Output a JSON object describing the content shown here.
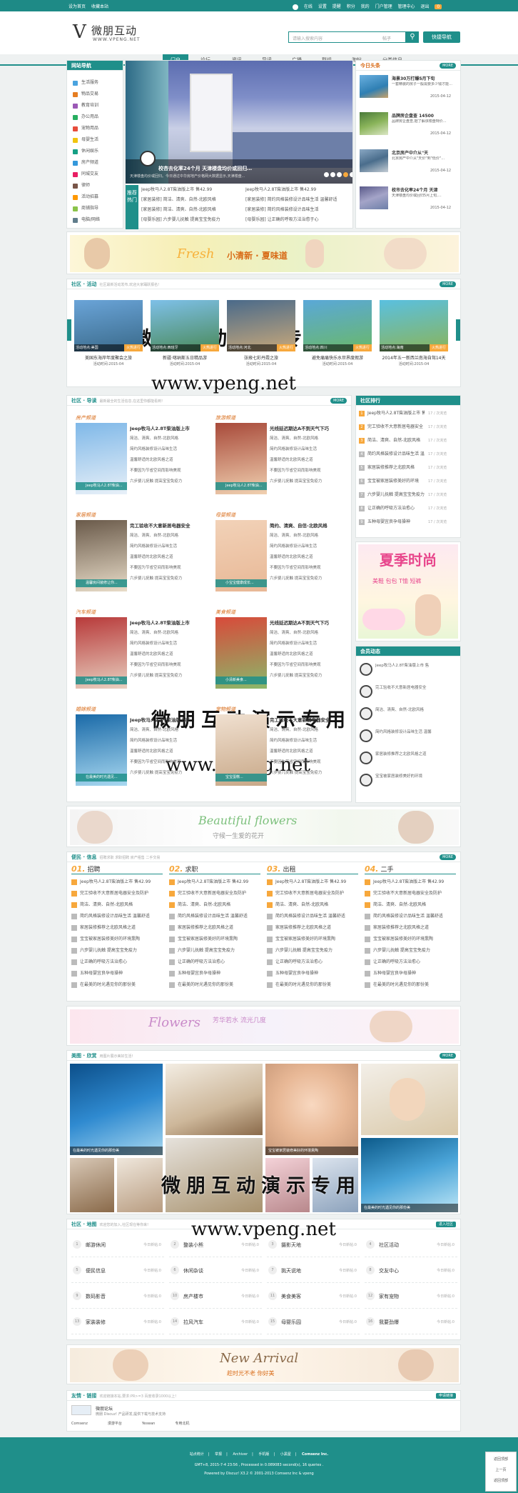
{
  "topbar": {
    "left": [
      "设为首页",
      "收藏本站"
    ],
    "right": [
      "在线",
      "设置",
      "提醒",
      "积分",
      "我的",
      "门户管理",
      "管理中心",
      "退出"
    ],
    "badge": "0"
  },
  "header": {
    "logo_text": "微朋互动",
    "logo_url": "WWW.VPENG.NET",
    "search_placeholder": "请输入搜索内容",
    "search_type": "帖子",
    "quick_nav": "快捷导航"
  },
  "nav": [
    "门户",
    "论坛",
    "资讯",
    "导读",
    "广播",
    "群组",
    "淘帖",
    "分类信息"
  ],
  "sidebar": {
    "title": "网站导航",
    "items": [
      "生活服务",
      "物品交易",
      "教育培训",
      "办公用品",
      "宠物用品",
      "母婴生活",
      "休闲娱乐",
      "房产频道",
      "同城交友",
      "律师",
      "活动招募",
      "商铺指导",
      "电脑/网络"
    ]
  },
  "slider": {
    "caption": "校杏去化率24个月 天津楼盘均价或回归…",
    "desc": "天津楼盘均价或回归。今日通过中华房地产价格网大数据显示,天津楼盘...",
    "dots": [
      "1",
      "2",
      "3",
      "4",
      "5"
    ]
  },
  "recommend": {
    "label": "推荐热门",
    "rows": [
      [
        "Jeep牧马人2.8T柴油版上市 售42.99",
        "Jeep牧马人2.8T柴油版上市 售42.99"
      ],
      [
        "[家居装修] 简洁、清爽、自然-北欧风格",
        "[家居装修] 简约风格装修设计品味生活 温馨舒适"
      ],
      [
        "[家居装修] 简洁、清爽、自然-北欧风格",
        "[家居装修] 简约风格装修设计品味生活"
      ],
      [
        "[母婴乐园] 六步婴儿抚触 提高宝宝免疫力",
        "[母婴乐园] 让正确的呼吸方法治愈于心"
      ]
    ]
  },
  "today": {
    "title": "今日头条",
    "more": "MORE",
    "items": [
      {
        "t": "海景30万打爆5月下旬",
        "d": "一套精装的房子一般需要多少钱才能…",
        "date": "2015-04-12"
      },
      {
        "t": "品牌房企盘查 14500",
        "d": "品牌房企盘查,据了解该楼盘特价…",
        "date": "2015-04-12"
      },
      {
        "t": "北京房产中介从\"天",
        "d": "北京房产中介从\"天价\"到\"低价\"…",
        "date": "2015-04-12"
      },
      {
        "t": "校市去化率24个月 天津",
        "d": "天津楼盘均价或回归5月上旬,…",
        "date": "2015-04-12"
      }
    ]
  },
  "banner1": {
    "text": "小清新 · 夏味道",
    "script": "Fresh"
  },
  "activity": {
    "title": "社区 · 活动",
    "sub": "社区最新活动发布,欢迎大家踊跃报名!",
    "more": "MORE",
    "items": [
      {
        "place": "活动地点:美国",
        "status": "火热进行",
        "t": "美国东海岸年度聚会之旅",
        "d": "活动时间:2015-04"
      },
      {
        "place": "活动地点:西班牙",
        "status": "火热进行",
        "t": "新疆·喀纳斯五日精品游",
        "d": "活动时间:2015-04"
      },
      {
        "place": "活动地点:河北",
        "status": "火热进行",
        "t": "张掖七彩丹霞之旅",
        "d": "活动时间:2015-04"
      },
      {
        "place": "活动地点:四川",
        "status": "火热进行",
        "t": "避免痛痛快乐水世界度假游",
        "d": "活动时间:2015-04"
      },
      {
        "place": "活动地点:海南",
        "status": "火热进行",
        "t": "2014年五一新西兰南海自驾14天",
        "d": "活动时间:2015-04"
      }
    ]
  },
  "watermark": {
    "cn": "微朋互动演示专用",
    "url": "www.vpeng.net"
  },
  "guide": {
    "title": "社区 · 导读",
    "sub": "最新最全的生活信息,在这里你都能看到!",
    "more": "MORE",
    "cats": [
      {
        "name": "房产频道",
        "t": "Jeep牧马人2.8T柴油版上市",
        "tag": "Jeep牧马人2.8T柴油..."
      },
      {
        "name": "旅游频道",
        "t": "光线延迟期达A不到天气下巧",
        "tag": "Jeep牧马人2.8T柴油..."
      },
      {
        "name": "家居频道",
        "t": "完工验收不大意新居电器安全",
        "tag": "温馨房间装修让你..."
      },
      {
        "name": "母婴频道",
        "t": "简约、清爽、自信-北欧风格",
        "tag": "小宝宝健康成长..."
      },
      {
        "name": "汽车频道",
        "t": "Jeep牧马人2.8T柴油版上市",
        "tag": "Jeep牧马人2.8T柴油..."
      },
      {
        "name": "美食频道",
        "t": "光线延迟期达A不到天气下巧",
        "tag": "小清新美食..."
      },
      {
        "name": "婚嫁频道",
        "t": "Jeep牧马人2.8T柴油版上市",
        "tag": "在最美的时光遇见..."
      },
      {
        "name": "宠物频道",
        "t": "完工验收不大意新居电器安全",
        "tag": "宝宝蛋糕..."
      }
    ],
    "lines": [
      "简洁、清爽、自然-北欧风格",
      "简约风格装修设计品味生活",
      "温馨舒适的北欧风格之道",
      "不要因为节省空间而影响美观",
      "六步婴儿抚触 提高宝宝免疫力"
    ]
  },
  "rank": {
    "title": "社区排行",
    "items": [
      "Jeep牧马人2.8T柴油版上市 售",
      "完工验收不大意新居电器安全",
      "简洁、清爽、自然-北欧风格",
      "简约风格装修设计品味生活 温",
      "家居装修推荐之北欧风格",
      "宝宝被家居装修美好的环境",
      "六步婴儿抚触 提高宝宝免疫力",
      "让正确的呼吸方法治愈心",
      "五种母婴宜良孕母操神"
    ],
    "dates": [
      "17 / 次浏览",
      "17 / 次浏览",
      "17 / 次浏览",
      "17 / 次浏览",
      "17 / 次浏览",
      "17 / 次浏览",
      "17 / 次浏览",
      "17 / 次浏览",
      "17 / 次浏览"
    ]
  },
  "summer": {
    "t1": "夏季时尚",
    "t2": "美鞋 包包 T恤 短裤"
  },
  "member": {
    "title": "会员动态",
    "items": [
      "Jeep牧马人2.8T柴油版上市 售",
      "完工验收不大意新居电器安全",
      "简洁、清爽、自然-北欧风格",
      "简约风格装修设计品味生活 温馨",
      "家居装修推荐之北欧风格之道",
      "宝宝被家居装修美好的环境"
    ]
  },
  "banner2": {
    "text": "Beautiful flowers",
    "sub": "守候一生爱的花开"
  },
  "info": {
    "title": "便民 · 信息",
    "sub": "招聘求职 求职招聘 房产租售 二手交易",
    "more": "MORE",
    "cols": [
      {
        "n": "01.",
        "t": "招聘"
      },
      {
        "n": "02.",
        "t": "求职"
      },
      {
        "n": "03.",
        "t": "出租"
      },
      {
        "n": "04.",
        "t": "二手"
      }
    ],
    "lines": [
      "Jeep牧马人2.8T柴油版上市 售42.99",
      "完工验收不大意新居电器安全及防护",
      "简洁、清爽、自然-北欧风格",
      "简约风格装修设计品味生活 温馨舒适",
      "家居装修推荐之北欧风格之道",
      "宝宝被家居装修美好的环境熏陶",
      "六步婴儿抚触 提高宝宝免疫力",
      "让正确的呼吸方法治愈心",
      "五种母婴宜良孕母操神",
      "在最美的时光遇见你的那份美"
    ]
  },
  "banner3": {
    "text": "Flowers",
    "sub": "芳华若水 流光几度"
  },
  "gallery": {
    "title": "美图 · 欣赏",
    "sub": "用图片展示美好生活!",
    "more": "MORE",
    "caps": [
      "在最美的时光遇见你的那份美",
      "宝宝被家居装修美好的环境熏陶",
      "在最美的时光遇见你的那份美"
    ]
  },
  "forum": {
    "title": "社区 · 地图",
    "sub": "欢迎您的加入,社区现在等你来!",
    "btn": "进入社区",
    "items": [
      {
        "n": "1",
        "t": "邮游休闲",
        "c": "今日新帖:0"
      },
      {
        "n": "2",
        "t": "整装小熊",
        "c": "今日新帖:0"
      },
      {
        "n": "3",
        "t": "摄影天地",
        "c": "今日新帖:0"
      },
      {
        "n": "4",
        "t": "社区活动",
        "c": "今日新帖:0"
      },
      {
        "n": "5",
        "t": "便民信息",
        "c": "今日新帖:0"
      },
      {
        "n": "6",
        "t": "休闲杂谈",
        "c": "今日新帖:0"
      },
      {
        "n": "7",
        "t": "挑天说地",
        "c": "今日新帖:0"
      },
      {
        "n": "8",
        "t": "交友中心",
        "c": "今日新帖:0"
      },
      {
        "n": "9",
        "t": "数码影音",
        "c": "今日新帖:0"
      },
      {
        "n": "10",
        "t": "房产楼市",
        "c": "今日新帖:0"
      },
      {
        "n": "11",
        "t": "美食美客",
        "c": "今日新帖:0"
      },
      {
        "n": "12",
        "t": "家有宠物",
        "c": "今日新帖:0"
      },
      {
        "n": "13",
        "t": "家装装修",
        "c": "今日新帖:0"
      },
      {
        "n": "14",
        "t": "拉风汽车",
        "c": "今日新帖:0"
      },
      {
        "n": "15",
        "t": "母婴乐园",
        "c": "今日新帖:0"
      },
      {
        "n": "16",
        "t": "我要劲爆",
        "c": "今日新帖:0"
      }
    ]
  },
  "banner4": {
    "text": "New Arrival",
    "sub": "趁时光不老 你好美"
  },
  "links": {
    "title": "友情 · 链接",
    "sub": "欢迎链接本站,要求:PR>=3 百度收录1000以上!",
    "btn": "申请链接",
    "site": "微朋论坛",
    "site_d": "微朋 Discuz! 产品研发,提供下载与技术支持",
    "items": [
      "Comsenz",
      "漫游平台",
      "Yeswan",
      "专用北机"
    ]
  },
  "footer": {
    "links": [
      "站点统计",
      "举报",
      "Archiver",
      "手机版",
      "小黑屋",
      "Comsenz Inc."
    ],
    "line2": "GMT+8, 2015-7-4 23:56 , Processed in 0.089083 second(s), 16 queries .",
    "line3": "Powered by Discuz! X3.2 © 2001-2013 Comsenz Inc & vpeng"
  },
  "sidefloat": {
    "a": "返回顶部",
    "b": "上一页",
    "c": "返回顶部"
  },
  "colors": {
    "accent": "#1f8f8a",
    "orange": "#f7a83c"
  }
}
